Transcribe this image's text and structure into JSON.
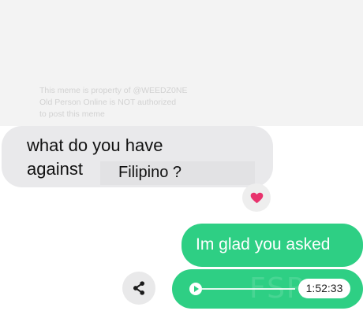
{
  "watermark": {
    "lines": [
      "This meme is property of @WEEDZ0NE",
      "Old Person Online is NOT authorized",
      "to post this meme"
    ]
  },
  "incoming_message": {
    "line1": "what do you have",
    "line2": "against",
    "overlay_text": "Filipino ?"
  },
  "reaction": {
    "icon": "heart-icon",
    "color": "#e8336d"
  },
  "outgoing_message": {
    "text": "Im glad you asked"
  },
  "voice_message": {
    "duration": "1:52:33",
    "play_icon": "play-icon",
    "share_icon": "share-icon",
    "bubble_color": "#2ecf84"
  }
}
